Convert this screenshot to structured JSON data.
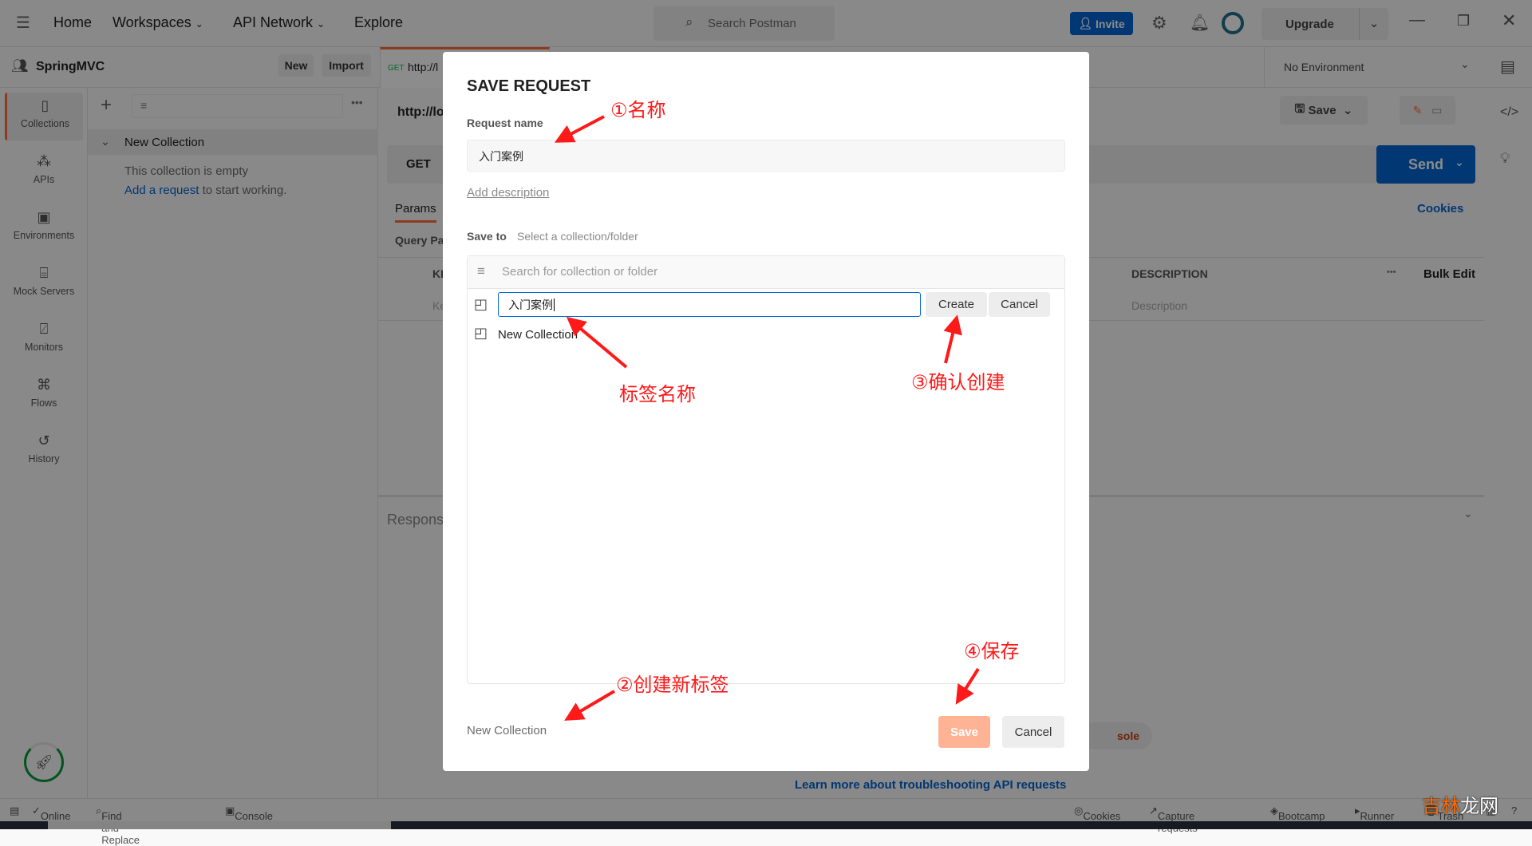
{
  "topbar": {
    "nav": [
      "Home",
      "Workspaces",
      "API Network",
      "Explore"
    ],
    "search_placeholder": "Search Postman",
    "invite": "Invite",
    "upgrade": "Upgrade"
  },
  "workspace": {
    "name": "SpringMVC",
    "new": "New",
    "import": "Import"
  },
  "tab": {
    "method": "GET",
    "url": "http://l"
  },
  "environment": "No Environment",
  "sidebar": {
    "items": [
      {
        "label": "Collections",
        "icon": "collections-icon"
      },
      {
        "label": "APIs",
        "icon": "apis-icon"
      },
      {
        "label": "Environments",
        "icon": "environments-icon"
      },
      {
        "label": "Mock Servers",
        "icon": "mock-servers-icon"
      },
      {
        "label": "Monitors",
        "icon": "monitors-icon"
      },
      {
        "label": "Flows",
        "icon": "flows-icon"
      },
      {
        "label": "History",
        "icon": "history-icon"
      }
    ]
  },
  "collections": {
    "item": "New Collection",
    "empty": "This collection is empty",
    "add_link": "Add a request",
    "add_rest": " to start working."
  },
  "request": {
    "url": "http://lo",
    "method": "GET",
    "save": "Save",
    "send": "Send",
    "params_tab": "Params",
    "cookies": "Cookies",
    "query_params": "Query Pa",
    "key_col": "KE",
    "key_placeholder": "Ke",
    "desc_col": "DESCRIPTION",
    "bulk_edit": "Bulk Edit",
    "desc_placeholder": "Description",
    "response": "Respons",
    "console_pill": "sole",
    "learn_more": "Learn more about troubleshooting API requests"
  },
  "status": {
    "online": "Online",
    "find": "Find and Replace",
    "console": "Console",
    "cookies": "Cookies",
    "capture": "Capture requests",
    "bootcamp": "Bootcamp",
    "runner": "Runner",
    "trash": "Trash"
  },
  "modal": {
    "title": "SAVE REQUEST",
    "request_name_label": "Request name",
    "request_name": "入门案例",
    "add_description": "Add description",
    "save_to_label": "Save to",
    "save_to_hint": "Select a collection/folder",
    "search_placeholder": "Search for collection or folder",
    "new_folder_value": "入门案例",
    "create": "Create",
    "cancel_create": "Cancel",
    "collection_item": "New Collection",
    "footer_new_collection": "New Collection",
    "save": "Save",
    "cancel": "Cancel"
  },
  "annotations": {
    "a1": "①名称",
    "a_tag": "标签名称",
    "a3": "③确认创建",
    "a2": "②创建新标签",
    "a4": "④保存"
  },
  "watermark": "吉林龙网",
  "colors": {
    "accent": "#ff6c37",
    "blue": "#0265d2",
    "annotation": "#ff1a1a",
    "save_disabled": "#ffb395"
  }
}
